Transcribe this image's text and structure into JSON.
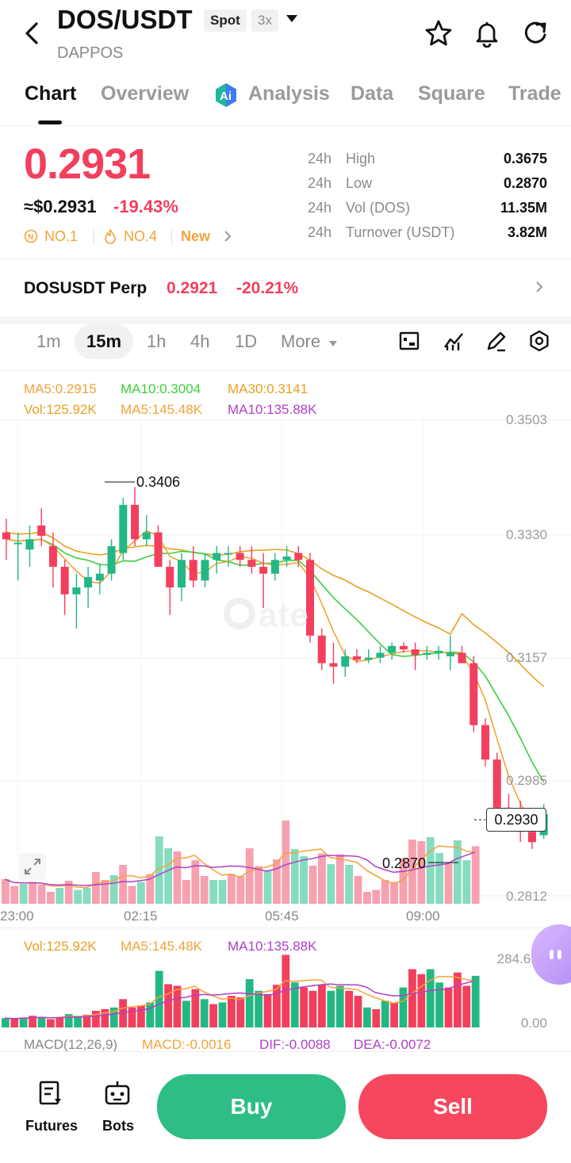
{
  "header": {
    "pair": "DOS/USDT",
    "market_tag": "Spot",
    "leverage_tag": "3x",
    "project": "DAPPOS"
  },
  "tabs": [
    "Chart",
    "Overview",
    "Analysis",
    "Data",
    "Square",
    "Trade"
  ],
  "price": {
    "last": "0.2931",
    "usd": "≈$0.2931",
    "change": "-19.43%",
    "rank1": "NO.1",
    "rank2": "NO.4",
    "new_label": "New"
  },
  "stats": [
    {
      "k1": "24h",
      "k2": "High",
      "v": "0.3675"
    },
    {
      "k1": "24h",
      "k2": "Low",
      "v": "0.2870"
    },
    {
      "k1": "24h",
      "k2": "Vol (DOS)",
      "v": "11.35M"
    },
    {
      "k1": "24h",
      "k2": "Turnover (USDT)",
      "v": "3.82M"
    }
  ],
  "perp": {
    "name": "DOSUSDT Perp",
    "price": "0.2921",
    "change": "-20.21%"
  },
  "timeframes": [
    "1m",
    "15m",
    "1h",
    "4h",
    "1D",
    "More"
  ],
  "active_timeframe": "15m",
  "chart_data": {
    "type": "candlestick",
    "ma_legend": {
      "ma5": "MA5:0.2915",
      "ma10": "MA10:0.3004",
      "ma30": "MA30:0.3141"
    },
    "vol_legend": {
      "vol": "Vol:125.92K",
      "ma5": "MA5:145.48K",
      "ma10": "MA10:135.88K"
    },
    "y_ticks": [
      "0.3503",
      "0.3330",
      "0.3157",
      "0.2985",
      "0.2812"
    ],
    "x_ticks": [
      "23:00",
      "02:15",
      "05:45",
      "09:00"
    ],
    "high_label": "0.3406",
    "low_label": "0.2870",
    "current_label": "0.2930",
    "vol_axis_top": "284.69K",
    "vol_axis_bottom": "0.00",
    "macd_legend": {
      "title": "MACD(12,26,9)",
      "macd": "MACD:-0.0016",
      "dif": "DIF:-0.0088",
      "dea": "DEA:-0.0072"
    },
    "colors": {
      "up": "#23b883",
      "down": "#f23f5d",
      "ma5": "#f2a33a",
      "ma10": "#3ccf3c",
      "ma30": "#e8a020",
      "vma10": "#b040c8"
    },
    "candles": [
      [
        0.334,
        0.336,
        0.33,
        0.333
      ],
      [
        0.3325,
        0.334,
        0.327,
        0.3325
      ],
      [
        0.3315,
        0.335,
        0.329,
        0.333
      ],
      [
        0.335,
        0.3375,
        0.332,
        0.3335
      ],
      [
        0.332,
        0.334,
        0.326,
        0.329
      ],
      [
        0.329,
        0.33,
        0.322,
        0.325
      ],
      [
        0.325,
        0.328,
        0.32,
        0.326
      ],
      [
        0.326,
        0.329,
        0.323,
        0.3275
      ],
      [
        0.327,
        0.3295,
        0.325,
        0.328
      ],
      [
        0.328,
        0.333,
        0.327,
        0.332
      ],
      [
        0.331,
        0.339,
        0.33,
        0.338
      ],
      [
        0.338,
        0.3406,
        0.332,
        0.333
      ],
      [
        0.333,
        0.3365,
        0.332,
        0.334
      ],
      [
        0.334,
        0.335,
        0.329,
        0.329
      ],
      [
        0.329,
        0.33,
        0.322,
        0.326
      ],
      [
        0.326,
        0.331,
        0.324,
        0.33
      ],
      [
        0.33,
        0.332,
        0.326,
        0.327
      ],
      [
        0.327,
        0.331,
        0.326,
        0.33
      ],
      [
        0.33,
        0.332,
        0.328,
        0.331
      ],
      [
        0.331,
        0.332,
        0.329,
        0.331
      ],
      [
        0.331,
        0.332,
        0.329,
        0.33
      ],
      [
        0.33,
        0.332,
        0.328,
        0.329
      ],
      [
        0.329,
        0.331,
        0.323,
        0.328
      ],
      [
        0.328,
        0.331,
        0.327,
        0.33
      ],
      [
        0.33,
        0.332,
        0.329,
        0.3305
      ],
      [
        0.331,
        0.332,
        0.329,
        0.33
      ],
      [
        0.33,
        0.331,
        0.318,
        0.319
      ],
      [
        0.319,
        0.32,
        0.314,
        0.315
      ],
      [
        0.315,
        0.318,
        0.312,
        0.3145
      ],
      [
        0.3145,
        0.317,
        0.313,
        0.316
      ],
      [
        0.316,
        0.317,
        0.315,
        0.3155
      ],
      [
        0.3155,
        0.317,
        0.315,
        0.3158
      ],
      [
        0.3158,
        0.3175,
        0.315,
        0.3165
      ],
      [
        0.3165,
        0.318,
        0.3155,
        0.3175
      ],
      [
        0.3175,
        0.318,
        0.3165,
        0.317
      ],
      [
        0.317,
        0.318,
        0.314,
        0.3162
      ],
      [
        0.3162,
        0.3175,
        0.3155,
        0.3165
      ],
      [
        0.3165,
        0.3175,
        0.3155,
        0.3168
      ],
      [
        0.316,
        0.319,
        0.314,
        0.3165
      ],
      [
        0.3165,
        0.3175,
        0.315,
        0.315
      ],
      [
        0.315,
        0.316,
        0.305,
        0.306
      ],
      [
        0.306,
        0.307,
        0.3,
        0.301
      ],
      [
        0.301,
        0.302,
        0.292,
        0.294
      ],
      [
        0.294,
        0.296,
        0.292,
        0.293
      ],
      [
        0.293,
        0.295,
        0.289,
        0.2905
      ],
      [
        0.2905,
        0.293,
        0.288,
        0.289
      ],
      [
        0.29,
        0.2945,
        0.2895,
        0.2931
      ]
    ],
    "volumes": [
      62,
      45,
      50,
      55,
      48,
      30,
      40,
      58,
      35,
      40,
      80,
      60,
      72,
      98,
      45,
      55,
      75,
      170,
      140,
      132,
      60,
      110,
      70,
      60,
      60,
      75,
      70,
      140,
      95,
      85,
      112,
      210,
      138,
      120,
      96,
      127,
      100,
      125,
      98,
      70,
      30,
      35,
      60,
      55,
      115,
      162,
      158,
      168,
      128,
      102,
      160,
      110,
      145
    ],
    "macd_volumes": [
      28,
      25,
      30,
      35,
      32,
      25,
      30,
      40,
      35,
      38,
      50,
      55,
      60,
      85,
      60,
      65,
      75,
      170,
      130,
      125,
      80,
      115,
      85,
      70,
      75,
      95,
      90,
      145,
      110,
      100,
      128,
      218,
      135,
      120,
      110,
      128,
      110,
      125,
      110,
      95,
      60,
      55,
      80,
      75,
      120,
      175,
      160,
      175,
      135,
      120,
      165,
      125,
      155
    ]
  }
}
